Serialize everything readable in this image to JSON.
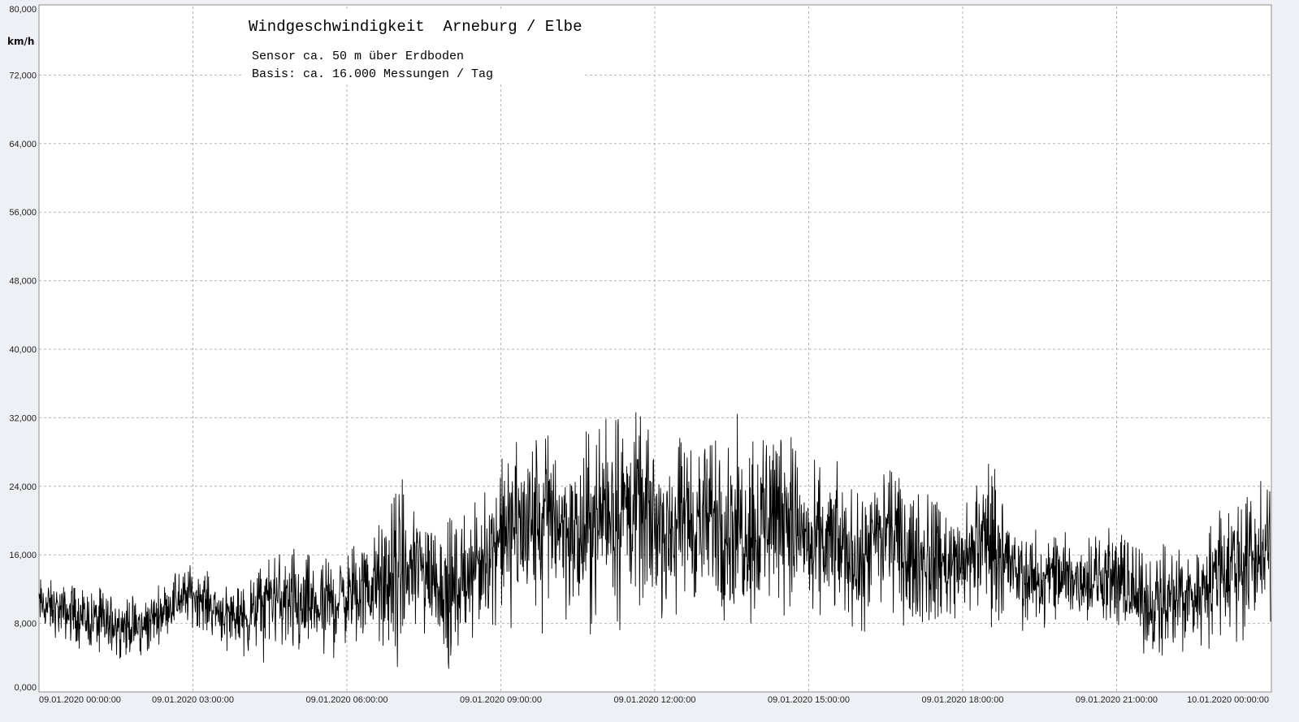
{
  "chart_data": {
    "type": "line",
    "title": "Windgeschwindigkeit  Arneburg / Elbe",
    "subtitle_lines": [
      "Sensor ca. 50 m über Erdboden",
      "Basis: ca. 16.000 Messungen / Tag"
    ],
    "ylabel": "km/h",
    "xlabel": "",
    "ylim": [
      0,
      80
    ],
    "xlim": [
      "09.01.2020 00:00:00",
      "10.01.2020 00:00:00"
    ],
    "grid": true,
    "y_tick_labels": [
      "0,000",
      "8,000",
      "16,000",
      "24,000",
      "32,000",
      "40,000",
      "48,000",
      "56,000",
      "64,000",
      "72,000",
      "80,000"
    ],
    "x_tick_labels": [
      "09.01.2020  00:00:00",
      "09.01.2020  03:00:00",
      "09.01.2020  06:00:00",
      "09.01.2020  09:00:00",
      "09.01.2020  12:00:00",
      "09.01.2020  15:00:00",
      "09.01.2020  18:00:00",
      "09.01.2020  21:00:00",
      "10.01.2020  00:00:00"
    ],
    "series": [
      {
        "color": "#000000",
        "x_hours": [
          0,
          0.5,
          1,
          1.5,
          2,
          2.5,
          3,
          3.5,
          4,
          4.5,
          5,
          5.5,
          6,
          6.5,
          7,
          7.5,
          8,
          8.5,
          9,
          9.5,
          10,
          10.5,
          11,
          11.5,
          12,
          12.5,
          13,
          13.5,
          14,
          14.5,
          15,
          15.5,
          16,
          16.5,
          17,
          17.5,
          18,
          18.5,
          19,
          19.5,
          20,
          20.5,
          21,
          21.5,
          22,
          22.5,
          23,
          23.5,
          24
        ],
        "mean": [
          10.5,
          9.5,
          8.5,
          8,
          7.5,
          10,
          11.5,
          9.5,
          8.5,
          11.5,
          11.5,
          10.5,
          11.5,
          13,
          13.5,
          15,
          13.5,
          15.5,
          16.5,
          19,
          20.5,
          18,
          20,
          21,
          20.5,
          21,
          20,
          21,
          20,
          22,
          19,
          17.5,
          16,
          19,
          15,
          15,
          14.5,
          19,
          14,
          13,
          13,
          12.5,
          14,
          9.5,
          11,
          11,
          14.5,
          15,
          16
        ],
        "upper": [
          13,
          12,
          11.5,
          11,
          10.5,
          12.5,
          14.5,
          12.5,
          11.5,
          15.5,
          15.5,
          14.5,
          16,
          17.5,
          22,
          20,
          18.5,
          20,
          26,
          29,
          29.5,
          26,
          31.5,
          30.5,
          28.5,
          28,
          27.5,
          28.5,
          28.5,
          31.5,
          24,
          24.5,
          21.5,
          25.5,
          22,
          21,
          19.5,
          26.5,
          18.5,
          17.5,
          18,
          17.5,
          18,
          15,
          15.5,
          16.5,
          20,
          22.5,
          22
        ],
        "lower": [
          7.5,
          6.5,
          5.5,
          5,
          4.5,
          7.5,
          8.5,
          6.5,
          5,
          7,
          4,
          5.5,
          6.5,
          7,
          5,
          9,
          5,
          9.5,
          10.5,
          9,
          13,
          8.5,
          11,
          12,
          11,
          11,
          11.5,
          10.5,
          10.5,
          13.5,
          10,
          10,
          9,
          12,
          8.5,
          9.5,
          10,
          10.5,
          9.5,
          8.5,
          8,
          8.5,
          9,
          5.5,
          6,
          6,
          8,
          8.5,
          10
        ],
        "min": [
          7,
          5,
          4.5,
          4,
          4,
          6.5,
          7.5,
          5,
          4,
          3,
          1.5,
          3.5,
          4,
          5,
          2,
          4,
          2,
          6,
          5,
          6,
          7,
          6,
          7,
          6.5,
          7.5,
          9,
          8,
          9,
          8,
          9,
          5,
          7,
          4.5,
          8.5,
          7,
          8.5,
          8,
          8.5,
          5.5,
          7,
          7,
          7,
          8,
          3,
          3.5,
          4,
          6,
          5.5,
          7
        ],
        "max": [
          14.5,
          13,
          12,
          12,
          11,
          14,
          15,
          13.5,
          13,
          16.5,
          17.5,
          16,
          17,
          19,
          24,
          21,
          21,
          22,
          28,
          31.5,
          31,
          27.5,
          32.5,
          32,
          30,
          30,
          29,
          30,
          30,
          32.5,
          28,
          27.5,
          23,
          27,
          25,
          23,
          21,
          27.5,
          20,
          19,
          20,
          19,
          19,
          17,
          17,
          18,
          21,
          23.5,
          23.5
        ]
      }
    ]
  }
}
